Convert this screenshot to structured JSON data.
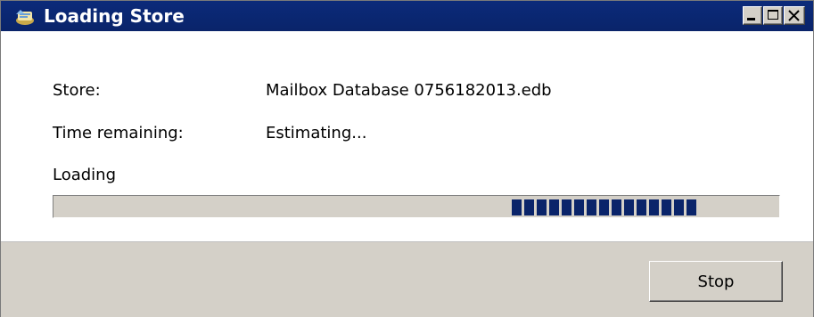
{
  "window": {
    "title": "Loading Store",
    "title_bar_color": "#0a246a",
    "icon": "store-icon",
    "controls": {
      "minimize_icon": "minimize-icon",
      "maximize_icon": "maximize-icon",
      "close_icon": "close-icon"
    }
  },
  "fields": {
    "store_label": "Store:",
    "store_value": "Mailbox Database 0756182013.edb",
    "time_label": "Time remaining:",
    "time_value": "Estimating..."
  },
  "progress": {
    "label": "Loading",
    "style": "marquee",
    "block_color": "#0a246a",
    "block_count": 15
  },
  "footer": {
    "stop_label": "Stop"
  }
}
